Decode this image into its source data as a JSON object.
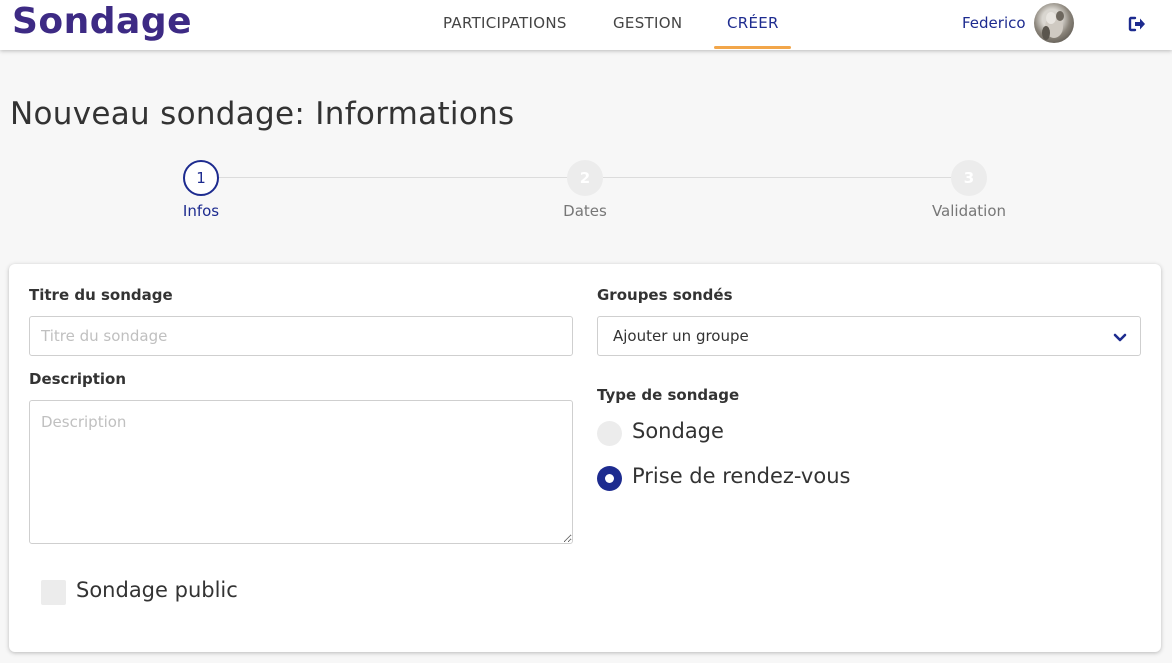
{
  "header": {
    "brand": "Sondage",
    "nav": [
      {
        "label": "PARTICIPATIONS"
      },
      {
        "label": "GESTION"
      },
      {
        "label": "CRÉER"
      }
    ],
    "user_name": "Federico",
    "accent_color": "#f2a64a",
    "brand_color": "#3d2a84",
    "logout_icon": "sign-out-icon"
  },
  "page": {
    "title": "Nouveau sondage: Informations"
  },
  "stepper": {
    "steps": [
      {
        "number": "1",
        "label": "Infos",
        "state": "active"
      },
      {
        "number": "2",
        "label": "Dates",
        "state": "inactive"
      },
      {
        "number": "3",
        "label": "Validation",
        "state": "inactive"
      }
    ]
  },
  "form": {
    "title_label": "Titre du sondage",
    "title_placeholder": "Titre du sondage",
    "description_label": "Description",
    "description_placeholder": "Description",
    "public_label": "Sondage public",
    "public_checked": false,
    "groups_label": "Groupes sondés",
    "groups_select_value": "Ajouter un groupe",
    "type_label": "Type de sondage",
    "type_options": [
      {
        "label": "Sondage",
        "selected": false
      },
      {
        "label": "Prise de rendez-vous",
        "selected": true
      }
    ]
  }
}
